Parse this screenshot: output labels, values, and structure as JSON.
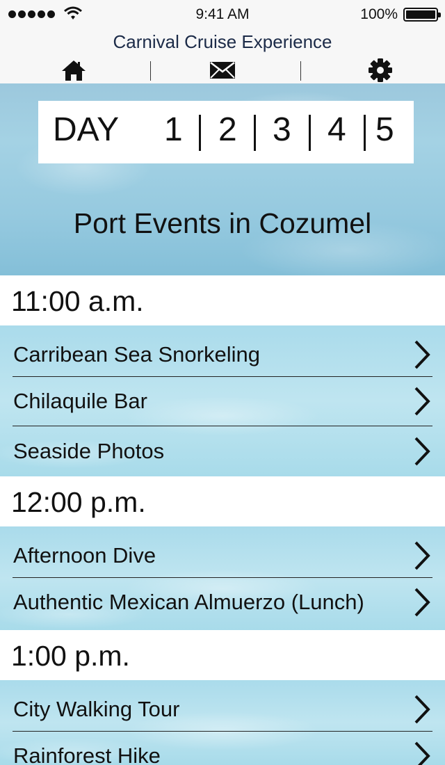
{
  "status_bar": {
    "time": "9:41 AM",
    "battery": "100%",
    "icons": [
      "signal-dots-icon",
      "wifi-icon",
      "battery-icon"
    ]
  },
  "header": {
    "title": "Carnival Cruise Experience",
    "nav": [
      "home-icon",
      "mail-icon",
      "gear-icon"
    ]
  },
  "day_selector": {
    "label": "DAY",
    "days": [
      "1",
      "2",
      "3",
      "4",
      "5"
    ]
  },
  "hero_title": "Port Events in Cozumel",
  "schedule": [
    {
      "time": "11:00 a.m.",
      "events": [
        "Carribean Sea Snorkeling",
        "Chilaquile Bar",
        "Seaside Photos"
      ]
    },
    {
      "time": "12:00 p.m.",
      "events": [
        "Afternoon Dive",
        "Authentic Mexican Almuerzo (Lunch)"
      ]
    },
    {
      "time": "1:00 p.m.",
      "events": [
        "City Walking Tour",
        "Rainforest Hike"
      ]
    }
  ],
  "colors": {
    "title_text": "#1c2b48",
    "header_bg": "#f7f7f7",
    "hero_blue": "#9cc8dd",
    "event_blue": "#aadbeb"
  }
}
